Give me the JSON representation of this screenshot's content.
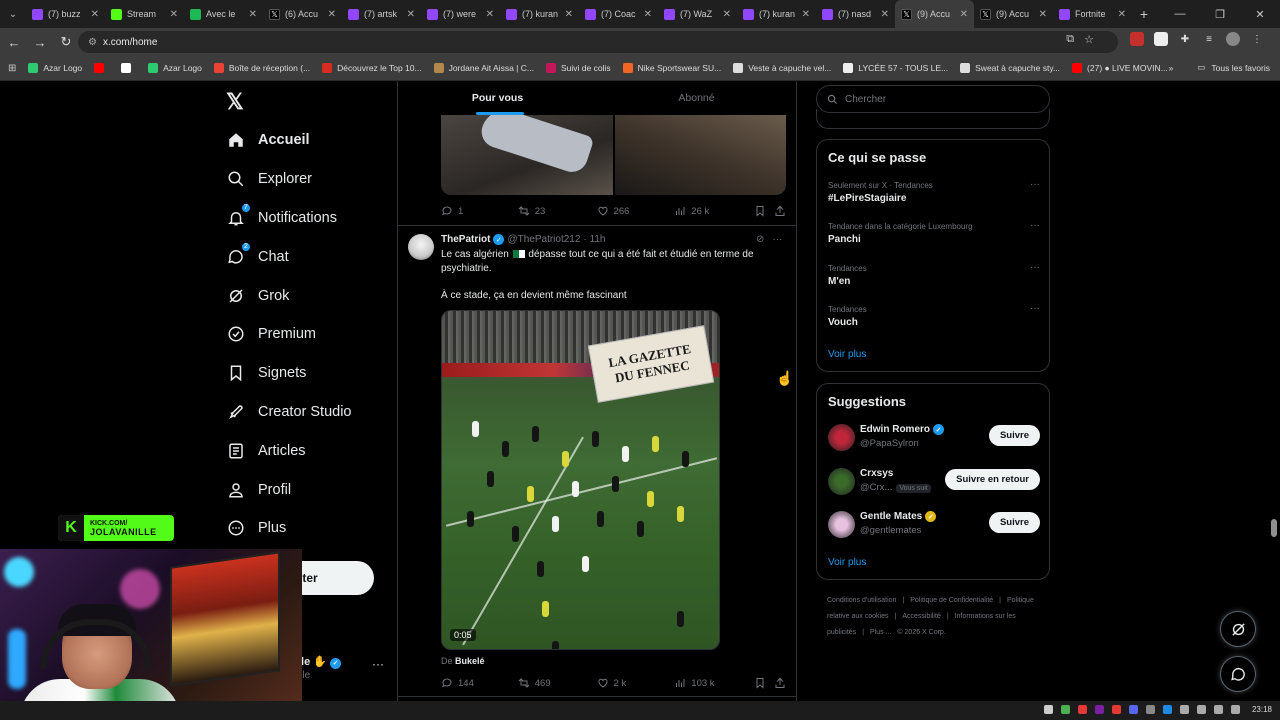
{
  "browser": {
    "tabs": [
      {
        "title": "(7) buzz",
        "icon": "twitch-icon",
        "color": "#9146ff"
      },
      {
        "title": "Stream",
        "icon": "kick-icon",
        "color": "#53fc18"
      },
      {
        "title": "Avec le",
        "icon": "spotify-icon",
        "color": "#1db954"
      },
      {
        "title": "(6) Accu",
        "icon": "x-icon",
        "color": "#000000"
      },
      {
        "title": "(7) artsk",
        "icon": "twitch-icon",
        "color": "#9146ff"
      },
      {
        "title": "(7) were",
        "icon": "twitch-icon",
        "color": "#9146ff"
      },
      {
        "title": "(7) kuran",
        "icon": "twitch-icon",
        "color": "#9146ff"
      },
      {
        "title": "(7) Coac",
        "icon": "twitch-icon",
        "color": "#9146ff"
      },
      {
        "title": "(7) WaZ",
        "icon": "twitch-icon",
        "color": "#9146ff"
      },
      {
        "title": "(7) kuran",
        "icon": "twitch-icon",
        "color": "#9146ff"
      },
      {
        "title": "(7) nasd",
        "icon": "twitch-icon",
        "color": "#9146ff"
      },
      {
        "title": "(9) Accu",
        "icon": "x-icon",
        "color": "#000000",
        "active": true
      },
      {
        "title": "(9) Accu",
        "icon": "x-icon",
        "color": "#000000"
      },
      {
        "title": "Fortnite",
        "icon": "twitch-icon",
        "color": "#9146ff"
      }
    ],
    "url": "x.com/home",
    "bookmarks": [
      {
        "label": "Azar Logo",
        "color": "#2ecc71"
      },
      {
        "label": "",
        "color": "#ff0000"
      },
      {
        "label": "",
        "color": "#ffffff"
      },
      {
        "label": "Azar Logo",
        "color": "#2ecc71"
      },
      {
        "label": "Boîte de réception (...",
        "color": "#ea4335"
      },
      {
        "label": "Découvrez le Top 10...",
        "color": "#d62d20"
      },
      {
        "label": "Jordane Ait Aissa | C...",
        "color": "#b0884a"
      },
      {
        "label": "Suivi de colis",
        "color": "#c2185b"
      },
      {
        "label": "Nike Sportswear SU...",
        "color": "#f26522"
      },
      {
        "label": "Veste à capuche vel...",
        "color": "#dddddd"
      },
      {
        "label": "LYCÉE 57 - TOUS LE...",
        "color": "#eeeeee"
      },
      {
        "label": "Sweat à capuche sty...",
        "color": "#dddddd"
      },
      {
        "label": "(27) ● LIVE MOVIN...",
        "color": "#ff0000"
      }
    ],
    "all_bookmarks": "Tous les favoris",
    "more": "»"
  },
  "sidebar": {
    "items": [
      {
        "label": "Accueil",
        "icon": "home-icon",
        "active": true
      },
      {
        "label": "Explorer",
        "icon": "search-icon"
      },
      {
        "label": "Notifications",
        "icon": "bell-icon",
        "badge": "7"
      },
      {
        "label": "Chat",
        "icon": "chat-icon",
        "badge": "2"
      },
      {
        "label": "Grok",
        "icon": "grok-icon"
      },
      {
        "label": "Premium",
        "icon": "premium-icon"
      },
      {
        "label": "Signets",
        "icon": "bookmark-icon"
      },
      {
        "label": "Creator Studio",
        "icon": "rocket-icon"
      },
      {
        "label": "Articles",
        "icon": "article-icon"
      },
      {
        "label": "Profil",
        "icon": "person-icon"
      },
      {
        "label": "Plus",
        "icon": "more-circle-icon"
      }
    ],
    "post_label": "ter",
    "profile_name": "lle",
    "profile_handle": "ille"
  },
  "feed": {
    "tabs": [
      "Pour vous",
      "Abonné"
    ],
    "tweet1_actions": {
      "replies": "1",
      "reposts": "23",
      "likes": "266",
      "views": "26 k"
    },
    "tweet2": {
      "name": "ThePatriot",
      "handle": "@ThePatriot212",
      "time": "· 11h",
      "text_line1a": "Le cas algérien",
      "text_line1b": "dépasse tout ce qui a été fait et étudié en terme de psychiatrie.",
      "text_line2": "À ce stade, ça en devient même fascinant",
      "video_time": "0:05",
      "banner_line1": "LA GAZETTE",
      "banner_line2": "DU FENNEC",
      "from_label": "De",
      "from_name": "Bukelé",
      "actions": {
        "replies": "144",
        "reposts": "469",
        "likes": "2 k",
        "views": "103 k"
      }
    }
  },
  "right": {
    "search_placeholder": "Chercher",
    "trends_title": "Ce qui se passe",
    "trends": [
      {
        "context": "Seulement sur X · Tendances",
        "name": "#LePireStagiaire"
      },
      {
        "context": "Tendance dans la catégorie Luxembourg",
        "name": "Panchi"
      },
      {
        "context": "Tendances",
        "name": "M'en"
      },
      {
        "context": "Tendances",
        "name": "Vouch"
      }
    ],
    "see_more": "Voir plus",
    "suggestions_title": "Suggestions",
    "suggestions": [
      {
        "name": "Edwin Romero",
        "handle": "@PapaSylron",
        "button": "Suivre",
        "verified": "blue",
        "color": "#c0263a"
      },
      {
        "name": "Crxsys",
        "handle": "@Crx...",
        "follows_you": "Vous suit",
        "button": "Suivre en retour",
        "color": "#3a6b2a"
      },
      {
        "name": "Gentle Mates",
        "handle": "@gentlemates",
        "button": "Suivre",
        "verified": "gold",
        "color": "#e8c1e0"
      }
    ],
    "footer": [
      "Conditions d'utilisation",
      "|",
      "Politique de Confidentialité",
      "|",
      "Politique relative aux cookies",
      "|",
      "Accessibilité",
      "|",
      "Informations sur les publicités",
      "|",
      "Plus ...",
      "© 2026 X Corp."
    ]
  },
  "overlay": {
    "kick_line1": "KICK.COM/",
    "kick_line2": "JOLAVANILLE"
  },
  "taskbar": {
    "time": "23:18"
  }
}
